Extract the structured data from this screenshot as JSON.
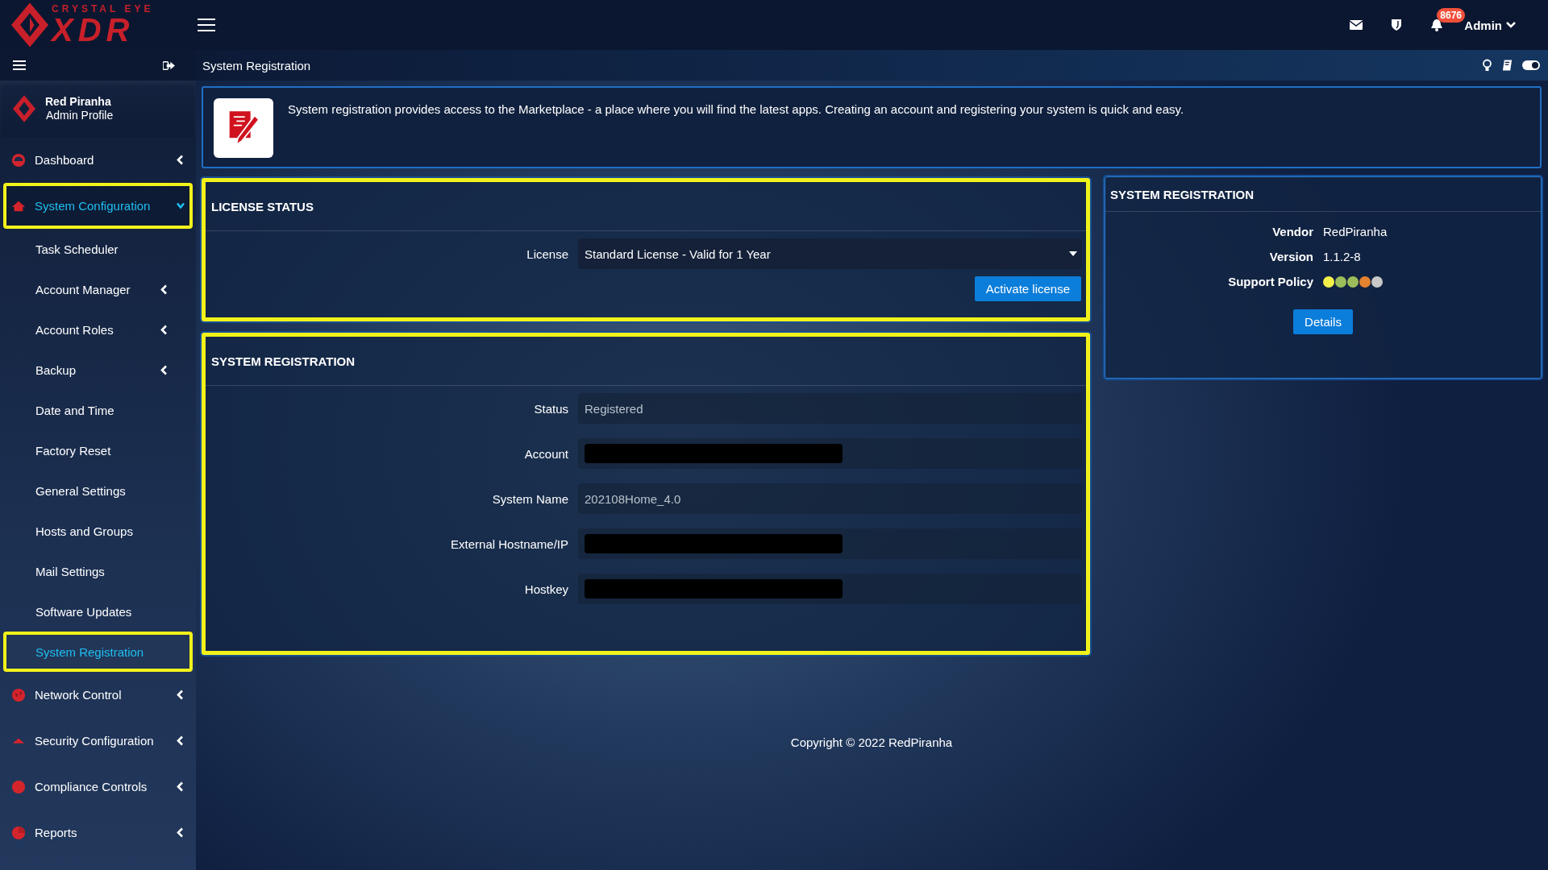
{
  "topbar": {
    "logo_top": "CRYSTAL EYE",
    "logo_main": "XDR",
    "notification_count": "8676",
    "user": "Admin"
  },
  "sidebar": {
    "profile": {
      "name": "Red Piranha",
      "role": "Admin Profile"
    },
    "items": [
      {
        "label": "Dashboard",
        "selected": false,
        "expanded": false
      },
      {
        "label": "System Configuration",
        "selected": true,
        "expanded": true,
        "children": [
          {
            "label": "Task Scheduler",
            "selected": false
          },
          {
            "label": "Account Manager",
            "selected": false,
            "expanded": false
          },
          {
            "label": "Account Roles",
            "selected": false,
            "expanded": false
          },
          {
            "label": "Backup",
            "selected": false,
            "expanded": false
          },
          {
            "label": "Date and Time",
            "selected": false
          },
          {
            "label": "Factory Reset",
            "selected": false
          },
          {
            "label": "General Settings",
            "selected": false
          },
          {
            "label": "Hosts and Groups",
            "selected": false
          },
          {
            "label": "Mail Settings",
            "selected": false
          },
          {
            "label": "Software Updates",
            "selected": false
          },
          {
            "label": "System Registration",
            "selected": true
          }
        ]
      },
      {
        "label": "Network Control",
        "selected": false,
        "expanded": false
      },
      {
        "label": "Security Configuration",
        "selected": false,
        "expanded": false
      },
      {
        "label": "Compliance Controls",
        "selected": false,
        "expanded": false
      },
      {
        "label": "Reports",
        "selected": false,
        "expanded": false
      }
    ]
  },
  "breadcrumb": "System Registration",
  "banner": {
    "text": "System registration provides access to the Marketplace - a place where you will find the latest apps. Creating an account and registering your system is quick and easy."
  },
  "license_panel": {
    "title": "LICENSE STATUS",
    "highlighted": true,
    "field": {
      "label": "License",
      "value": "Standard License - Valid for 1 Year"
    },
    "button": "Activate license"
  },
  "registration_panel": {
    "title": "SYSTEM REGISTRATION",
    "highlighted": true,
    "fields": [
      {
        "label": "Status",
        "value": "Registered",
        "redacted": false
      },
      {
        "label": "Account",
        "redacted": true
      },
      {
        "label": "System Name",
        "value": "202108Home_4.0",
        "redacted": false
      },
      {
        "label": "External Hostname/IP",
        "redacted": true
      },
      {
        "label": "Hostkey",
        "redacted": true
      }
    ]
  },
  "info_panel": {
    "title": "SYSTEM REGISTRATION",
    "highlighted": false,
    "rows": [
      {
        "label": "Vendor",
        "value": "RedPiranha"
      },
      {
        "label": "Version",
        "value": "1.1.2-8"
      }
    ],
    "support_policy": {
      "label": "Support Policy",
      "dots": [
        {
          "color": "#f3f04a"
        },
        {
          "color": "#9dbd5a"
        },
        {
          "color": "#9dbd5a"
        },
        {
          "color": "#e3822f"
        },
        {
          "color": "#c8c8c8"
        }
      ]
    },
    "button": "Details"
  },
  "footer": "Copyright © 2022 RedPiranha"
}
